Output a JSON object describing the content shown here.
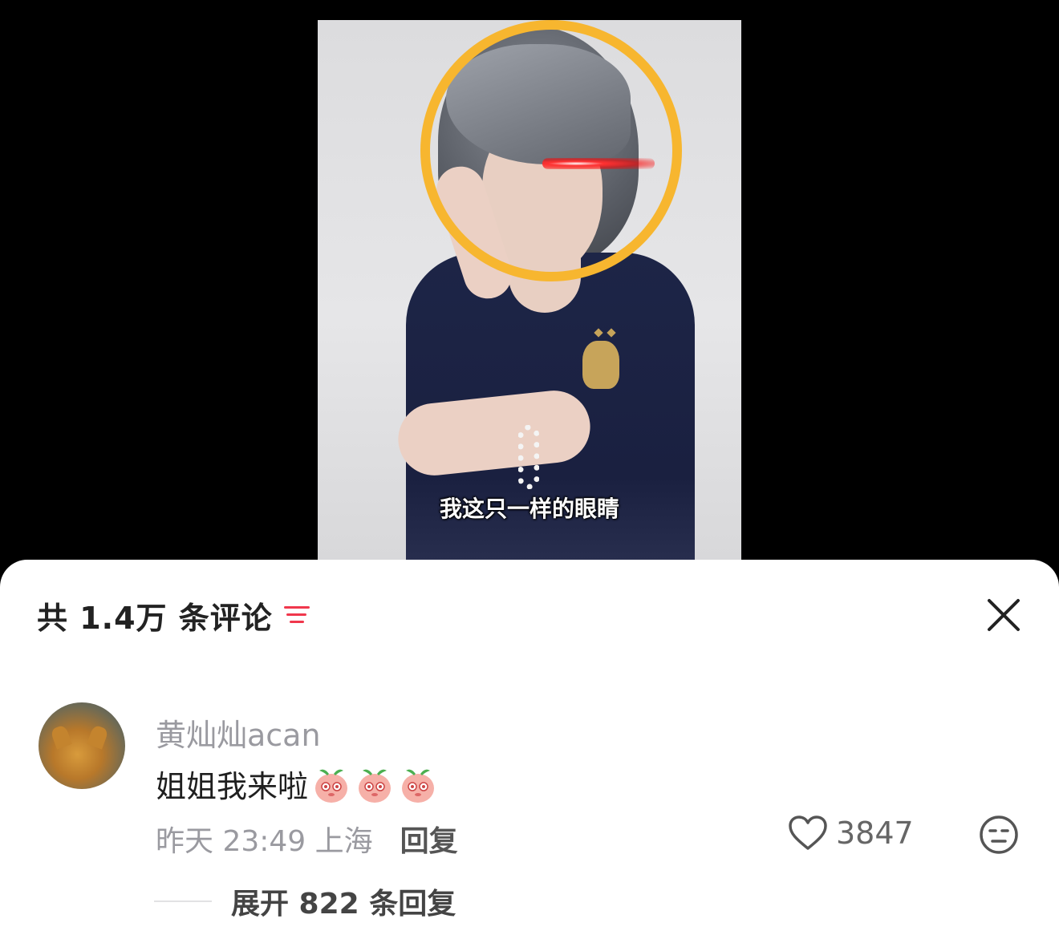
{
  "video": {
    "subtitle": "我这只一样的眼睛"
  },
  "comments_panel": {
    "title": "共 1.4万 条评论",
    "colors": {
      "accent": "#f0374c",
      "focus_ring": "#f7b62f"
    }
  },
  "comment": {
    "username": "黄灿灿acan",
    "text": "姐姐我来啦",
    "emojis": [
      "peach-face-emoji",
      "peach-face-emoji",
      "peach-face-emoji"
    ],
    "time_location": "昨天 23:49 上海",
    "reply_label": "回复",
    "likes": "3847",
    "expand_replies": "展开 822 条回复"
  }
}
